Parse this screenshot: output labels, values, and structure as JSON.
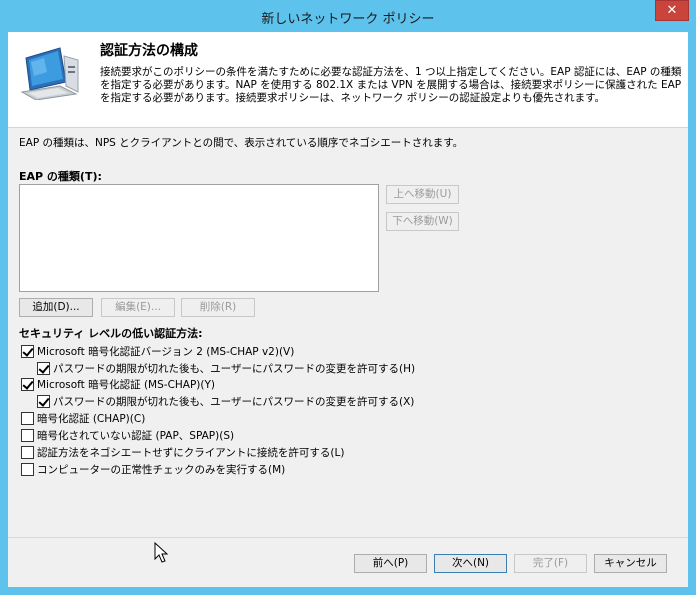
{
  "window": {
    "title": "新しいネットワーク ポリシー",
    "close_label": "✕"
  },
  "header": {
    "title": "認証方法の構成",
    "description": "接続要求がこのポリシーの条件を満たすために必要な認証方法を、1 つ以上指定してください。EAP 認証には、EAP の種類を指定する必要があります。NAP を使用する 802.1X または VPN を展開する場合は、接続要求ポリシーに保護された EAP を指定する必要があります。接続要求ポリシーは、ネットワーク ポリシーの認証設定よりも優先されます。",
    "icon": "computer-network-icon"
  },
  "intro_text": "EAP の種類は、NPS とクライアントとの間で、表示されている順序でネゴシエートされます。",
  "eap": {
    "list_label": "EAP の種類(T):",
    "items": [],
    "move_up_label": "上へ移動(U)",
    "move_down_label": "下へ移動(W)",
    "add_label": "追加(D)...",
    "edit_label": "編集(E)...",
    "remove_label": "削除(R)"
  },
  "less_secure": {
    "label": "セキュリティ レベルの低い認証方法:",
    "options": [
      {
        "label": "Microsoft 暗号化認証バージョン 2 (MS-CHAP v2)(V)",
        "checked": true
      },
      {
        "label": "パスワードの期限が切れた後も、ユーザーにパスワードの変更を許可する(H)",
        "checked": true
      },
      {
        "label": "Microsoft 暗号化認証 (MS-CHAP)(Y)",
        "checked": true
      },
      {
        "label": "パスワードの期限が切れた後も、ユーザーにパスワードの変更を許可する(X)",
        "checked": true
      },
      {
        "label": "暗号化認証 (CHAP)(C)",
        "checked": false
      },
      {
        "label": "暗号化されていない認証 (PAP、SPAP)(S)",
        "checked": false
      },
      {
        "label": "認証方法をネゴシエートせずにクライアントに接続を許可する(L)",
        "checked": false
      },
      {
        "label": "コンピューターの正常性チェックのみを実行する(M)",
        "checked": false
      }
    ]
  },
  "footer": {
    "back_label": "前へ(P)",
    "next_label": "次へ(N)",
    "finish_label": "完了(F)",
    "cancel_label": "キャンセル"
  }
}
